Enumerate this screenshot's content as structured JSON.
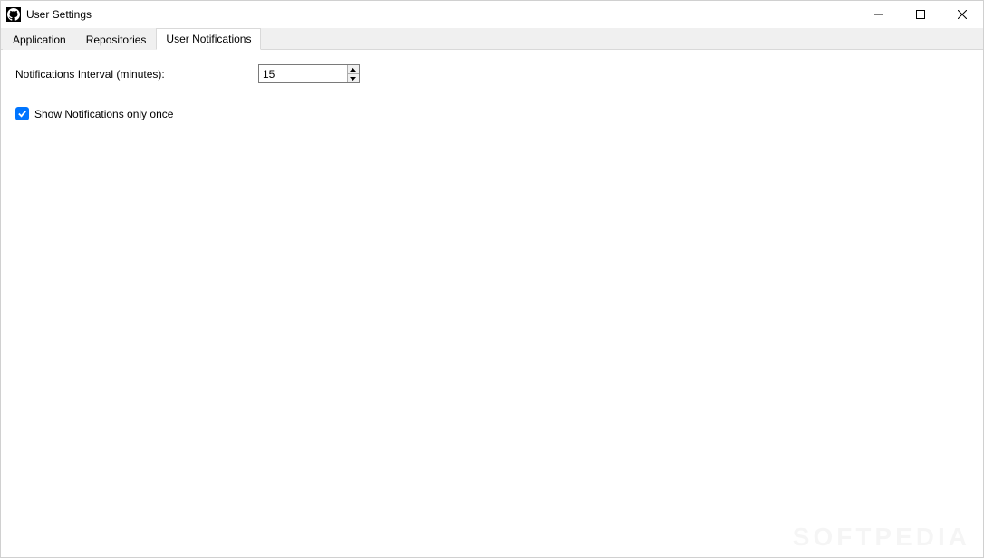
{
  "window": {
    "title": "User Settings"
  },
  "tabs": [
    {
      "label": "Application",
      "active": false
    },
    {
      "label": "Repositories",
      "active": false
    },
    {
      "label": "User Notifications",
      "active": true
    }
  ],
  "form": {
    "interval_label": "Notifications Interval (minutes):",
    "interval_value": "15",
    "show_once_checked": true,
    "show_once_label": "Show Notifications only once"
  },
  "watermark": "SOFTPEDIA"
}
